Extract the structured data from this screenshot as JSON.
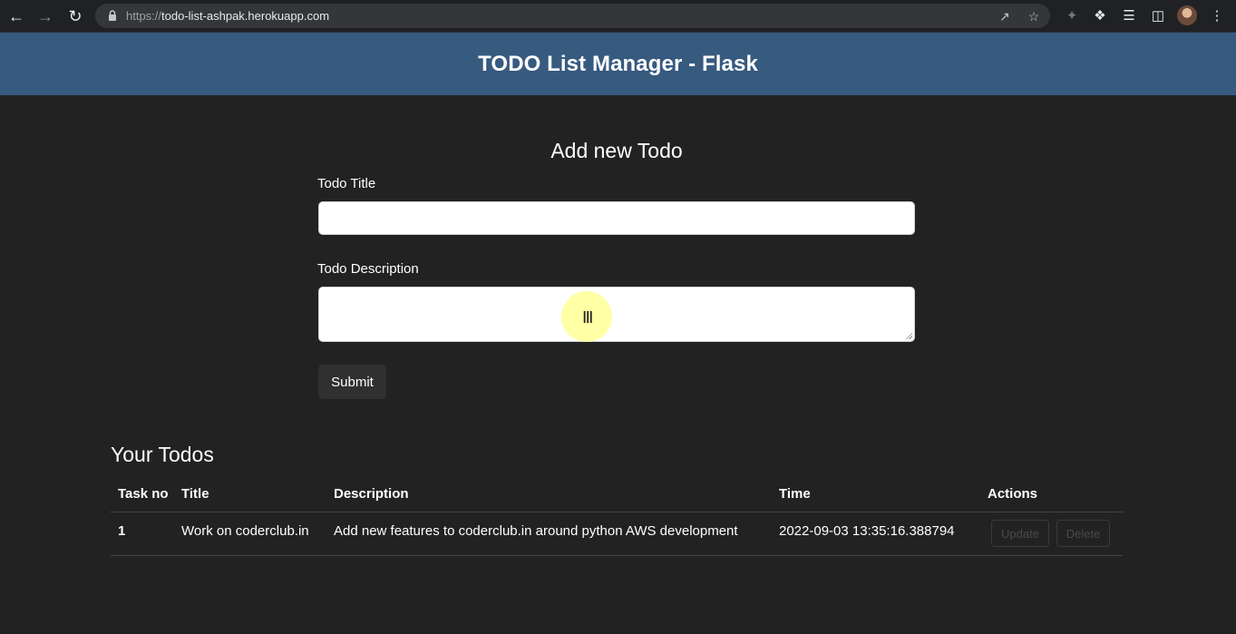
{
  "browser": {
    "url_scheme": "https://",
    "url_host": "todo-list-ashpak.herokuapp.com"
  },
  "header": {
    "title": "TODO List Manager - Flask"
  },
  "form": {
    "heading": "Add new Todo",
    "title_label": "Todo Title",
    "title_value": "",
    "description_label": "Todo Description",
    "description_value": "",
    "submit_label": "Submit"
  },
  "todos": {
    "heading": "Your Todos",
    "columns": [
      "Task no",
      "Title",
      "Description",
      "Time",
      "Actions"
    ],
    "rows": [
      {
        "task_no": "1",
        "title": "Work on coderclub.in",
        "description": "Add new features to coderclub.in around python AWS development",
        "time": "2022-09-03 13:35:16.388794",
        "update_label": "Update",
        "delete_label": "Delete"
      }
    ]
  },
  "colors": {
    "page_background": "#222222",
    "header_background": "#375a7f",
    "button_background": "#303030"
  },
  "icons": [
    "back-icon",
    "forward-icon",
    "reload-icon",
    "lock-icon",
    "share-icon",
    "bookmark-star-icon",
    "extension-icon",
    "puzzle-icon",
    "media-queue-icon",
    "side-panel-icon",
    "profile-avatar",
    "menu-dots-icon"
  ]
}
